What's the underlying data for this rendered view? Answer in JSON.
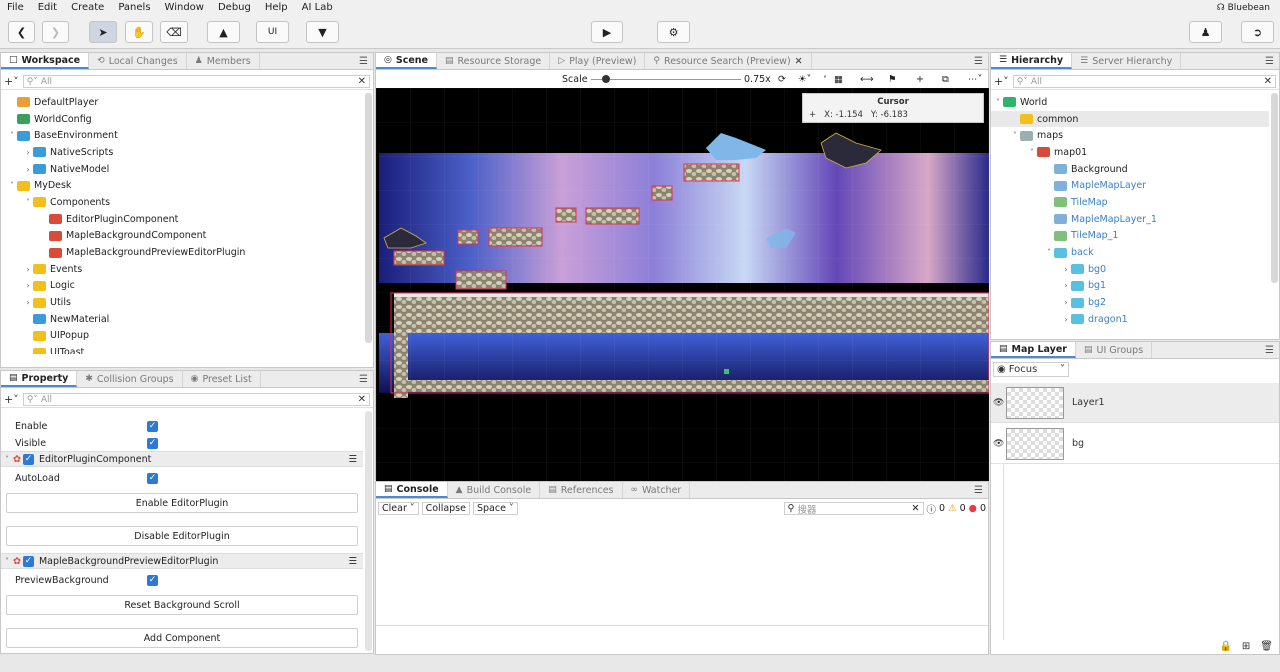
{
  "menu": {
    "items": [
      "File",
      "Edit",
      "Create",
      "Panels",
      "Window",
      "Debug",
      "Help",
      "AI Lab"
    ],
    "user": "Bluebean"
  },
  "workspace": {
    "tabs": [
      "Workspace",
      "Local Changes",
      "Members"
    ],
    "search_placeholder": "All",
    "tree": [
      {
        "label": "DefaultPlayer",
        "depth": 0,
        "arrow": "",
        "color": "#e8a030"
      },
      {
        "label": "WorldConfig",
        "depth": 0,
        "arrow": "",
        "color": "#3aa060"
      },
      {
        "label": "BaseEnvironment",
        "depth": 0,
        "arrow": "v",
        "color": "#3a9bd8"
      },
      {
        "label": "NativeScripts",
        "depth": 1,
        "arrow": ">",
        "color": "#3a9bd8"
      },
      {
        "label": "NativeModel",
        "depth": 1,
        "arrow": ">",
        "color": "#3a9bd8"
      },
      {
        "label": "MyDesk",
        "depth": 0,
        "arrow": "v",
        "color": "#f2c01a"
      },
      {
        "label": "Components",
        "depth": 1,
        "arrow": "v",
        "color": "#f2c01a"
      },
      {
        "label": "EditorPluginComponent",
        "depth": 2,
        "arrow": "",
        "color": "#d84a3a"
      },
      {
        "label": "MapleBackgroundComponent",
        "depth": 2,
        "arrow": "",
        "color": "#d84a3a"
      },
      {
        "label": "MapleBackgroundPreviewEditorPlugin",
        "depth": 2,
        "arrow": "",
        "color": "#d84a3a"
      },
      {
        "label": "Events",
        "depth": 1,
        "arrow": ">",
        "color": "#f2c01a"
      },
      {
        "label": "Logic",
        "depth": 1,
        "arrow": ">",
        "color": "#f2c01a"
      },
      {
        "label": "Utils",
        "depth": 1,
        "arrow": ">",
        "color": "#f2c01a"
      },
      {
        "label": "NewMaterial",
        "depth": 1,
        "arrow": "",
        "color": "#3a9bd8"
      },
      {
        "label": "UIPopup",
        "depth": 1,
        "arrow": "",
        "color": "#f2c01a"
      },
      {
        "label": "UIToast",
        "depth": 1,
        "arrow": "",
        "color": "#f2c01a"
      }
    ]
  },
  "property": {
    "tabs": [
      "Property",
      "Collision Groups",
      "Preset List"
    ],
    "search_placeholder": "All",
    "enable_label": "Enable",
    "visible_label": "Visible",
    "component1": "EditorPluginComponent",
    "autoload_label": "AutoLoad",
    "enable_btn": "Enable EditorPlugin",
    "disable_btn": "Disable EditorPlugin",
    "component2": "MapleBackgroundPreviewEditorPlugin",
    "preview_label": "PreviewBackground",
    "reset_btn": "Reset Background Scroll",
    "add_btn": "Add Component"
  },
  "scene": {
    "tabs": [
      "Scene",
      "Resource Storage",
      "Play (Preview)",
      "Resource Search (Preview)"
    ],
    "scale_label": "Scale",
    "scale_value": "0.75x",
    "cursor_title": "Cursor",
    "cursor_x": "X: -1.154",
    "cursor_y": "Y: -6.183"
  },
  "console": {
    "tabs": [
      "Console",
      "Build Console",
      "References",
      "Watcher"
    ],
    "clear": "Clear",
    "collapse": "Collapse",
    "space": "Space",
    "search_placeholder": "搜器",
    "info_count": "0",
    "warn_count": "0",
    "error_count": "0"
  },
  "hierarchy": {
    "tabs": [
      "Hierarchy",
      "Server Hierarchy"
    ],
    "search_placeholder": "All",
    "tree": [
      {
        "label": "World",
        "depth": 0,
        "arrow": "v",
        "color": "#2fb36a",
        "blue": false,
        "sel": false
      },
      {
        "label": "common",
        "depth": 1,
        "arrow": "",
        "color": "#f2c01a",
        "blue": false,
        "sel": true
      },
      {
        "label": "maps",
        "depth": 1,
        "arrow": "v",
        "color": "#9ab0b0",
        "blue": false,
        "sel": false
      },
      {
        "label": "map01",
        "depth": 2,
        "arrow": "v",
        "color": "#d84a3a",
        "blue": false,
        "sel": false
      },
      {
        "label": "Background",
        "depth": 3,
        "arrow": "",
        "color": "#7fb0d8",
        "blue": false,
        "sel": false
      },
      {
        "label": "MapleMapLayer",
        "depth": 3,
        "arrow": "",
        "color": "#7fb0d8",
        "blue": true,
        "sel": false
      },
      {
        "label": "TileMap",
        "depth": 3,
        "arrow": "",
        "color": "#7fc07a",
        "blue": true,
        "sel": false
      },
      {
        "label": "MapleMapLayer_1",
        "depth": 3,
        "arrow": "",
        "color": "#7fb0d8",
        "blue": true,
        "sel": false
      },
      {
        "label": "TileMap_1",
        "depth": 3,
        "arrow": "",
        "color": "#7fc07a",
        "blue": true,
        "sel": false
      },
      {
        "label": "back",
        "depth": 3,
        "arrow": "v",
        "color": "#5ac0e0",
        "blue": true,
        "sel": false
      },
      {
        "label": "bg0",
        "depth": 4,
        "arrow": ">",
        "color": "#5ac0e0",
        "blue": true,
        "sel": false
      },
      {
        "label": "bg1",
        "depth": 4,
        "arrow": ">",
        "color": "#5ac0e0",
        "blue": true,
        "sel": false
      },
      {
        "label": "bg2",
        "depth": 4,
        "arrow": ">",
        "color": "#5ac0e0",
        "blue": true,
        "sel": false
      },
      {
        "label": "dragon1",
        "depth": 4,
        "arrow": ">",
        "color": "#5ac0e0",
        "blue": true,
        "sel": false
      }
    ]
  },
  "maplayer": {
    "tabs": [
      "Map Layer",
      "UI Groups"
    ],
    "focus": "Focus",
    "layers": [
      "Layer1",
      "bg"
    ]
  }
}
